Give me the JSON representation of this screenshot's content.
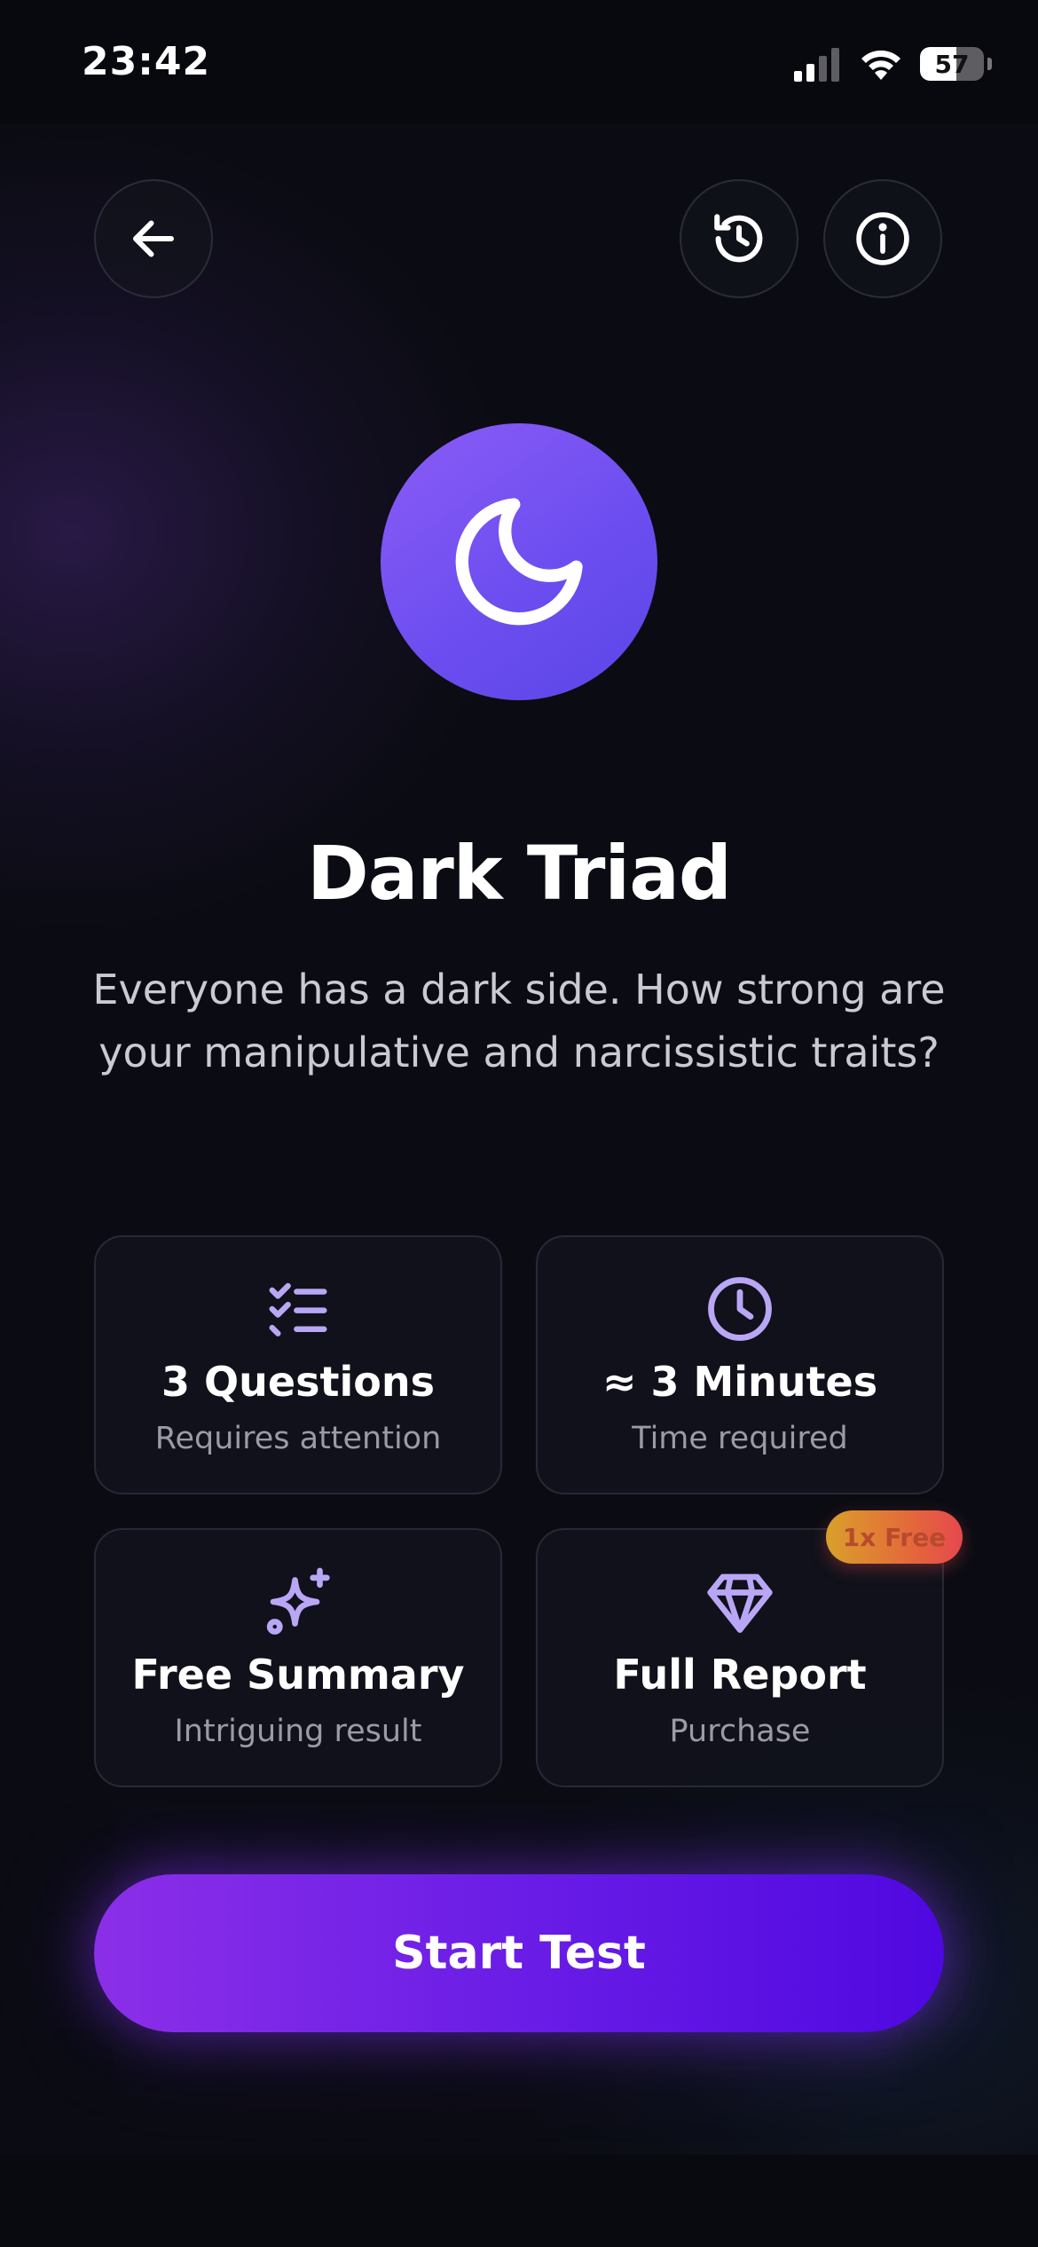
{
  "status_bar": {
    "time": "23:42",
    "battery": "57",
    "battery_level": 0.57
  },
  "header": {
    "back_icon": "arrow-left-icon",
    "history_icon": "history-icon",
    "info_icon": "info-icon"
  },
  "hero": {
    "icon": "moon-icon",
    "title": "Dark Triad",
    "description": "Everyone has a dark side. How strong are your manipulative and narcissistic traits?"
  },
  "cards": [
    {
      "icon": "checklist-icon",
      "title": "3 Questions",
      "subtitle": "Requires attention"
    },
    {
      "icon": "clock-icon",
      "title": "≈ 3 Minutes",
      "subtitle": "Time required"
    },
    {
      "icon": "sparkles-icon",
      "title": "Free Summary",
      "subtitle": "Intriguing result"
    },
    {
      "icon": "diamond-icon",
      "title": "Full Report",
      "subtitle": "Purchase",
      "badge": "1x Free"
    }
  ],
  "cta": {
    "label": "Start Test"
  },
  "colors": {
    "background": "#0b0c13",
    "accent": "#8b5cf6",
    "icon_lavender": "#b9a6f5",
    "cta_start": "#8b2fe8",
    "cta_end": "#4f08e0",
    "badge_start": "#d9a02a",
    "badge_end": "#e5484d"
  }
}
